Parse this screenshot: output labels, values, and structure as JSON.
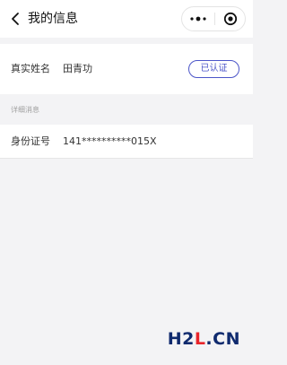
{
  "nav": {
    "title": "我的信息",
    "back_icon": "chevron-left-icon",
    "more_icon": "more-dots-icon",
    "close_icon": "target-circle-icon"
  },
  "profile": {
    "name_label": "真实姓名",
    "name_value": "田青功",
    "verify_badge": "已认证"
  },
  "details": {
    "section_title": "详细消息",
    "id_label": "身份证号",
    "id_value": "141**********015X"
  },
  "watermark": {
    "prefix": "H2",
    "accent": "L",
    "suffix": ".CN"
  },
  "colors": {
    "accent": "#4b55c8",
    "background": "#f3f3f5",
    "card": "#ffffff"
  }
}
